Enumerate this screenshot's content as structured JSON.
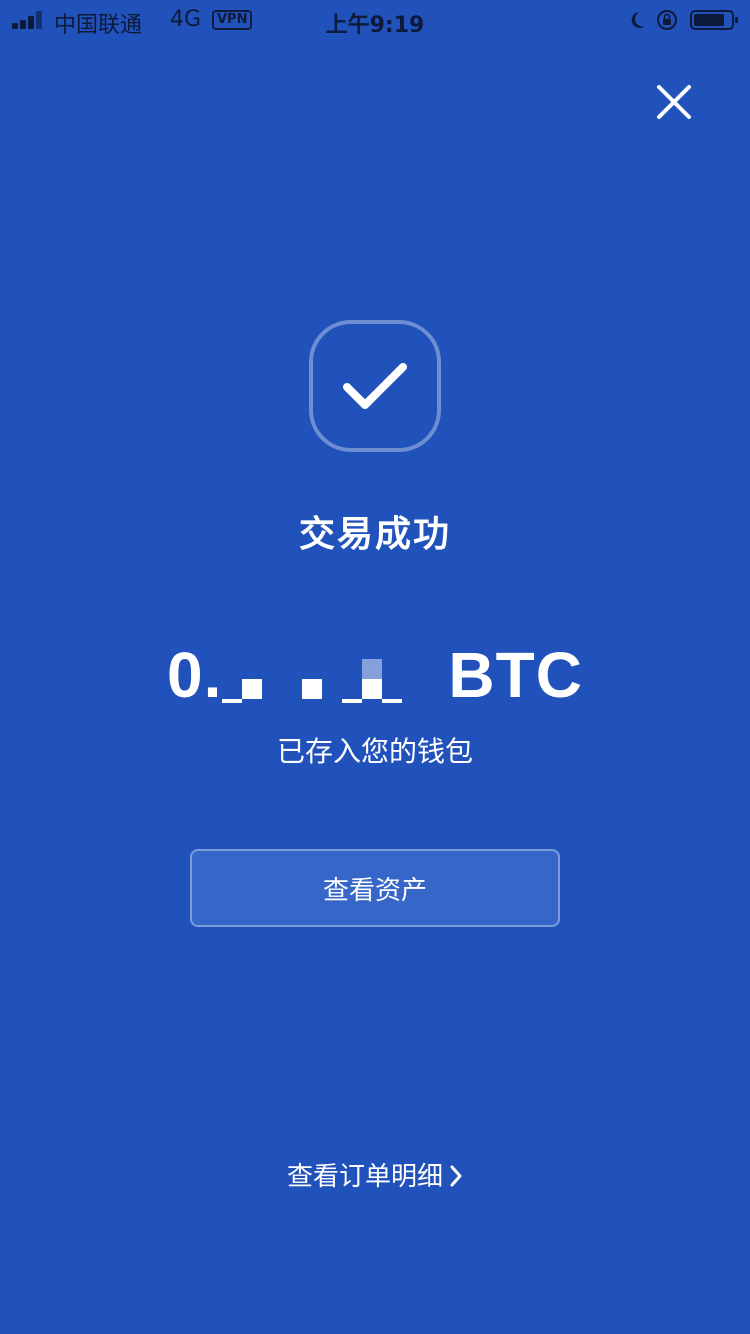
{
  "status_bar": {
    "carrier": "中国联通",
    "network": "4G",
    "vpn": "VPN",
    "time": "上午9:19",
    "icons": [
      "signal-icon",
      "moon-icon",
      "rotation-lock-icon",
      "battery-icon"
    ]
  },
  "header": {
    "close_icon": "close-icon"
  },
  "result": {
    "status_icon": "check-icon",
    "title": "交易成功",
    "amount_prefix": "0.",
    "amount_unit": "BTC",
    "subtitle": "已存入您的钱包"
  },
  "actions": {
    "view_assets_label": "查看资产",
    "view_order_details_label": "查看订单明细"
  },
  "colors": {
    "background": "#2152BC",
    "button_fill": "#3566C8",
    "text": "#FFFFFF"
  }
}
